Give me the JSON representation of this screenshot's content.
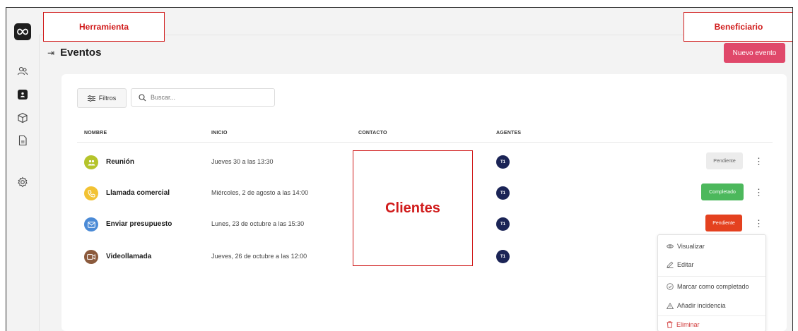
{
  "annotations": {
    "tool": "Herramienta",
    "beneficiary": "Beneficiario",
    "clients": "Clientes"
  },
  "sidebar": {
    "icons": [
      "infinity-logo-icon",
      "users-icon",
      "contact-book-icon",
      "cube-icon",
      "document-icon",
      "settings-icon"
    ],
    "active": "contact-book-icon"
  },
  "page": {
    "collapse_icon": "⇥",
    "title": "Eventos",
    "new_button": "Nuevo evento"
  },
  "toolbar": {
    "filters_label": "Filtros",
    "search_placeholder": "Buscar..."
  },
  "table": {
    "columns": [
      "NOMBRE",
      "INICIO",
      "CONTACTO",
      "AGENTES"
    ],
    "rows": [
      {
        "name": "Reunión",
        "date": "Jueves 30 a las 13:30",
        "agent": "T1",
        "status": "Pendiente",
        "icon": "meeting-icon",
        "icon_color": "#b5c42b",
        "status_bg": "#ececec",
        "status_fg": "#666666"
      },
      {
        "name": "Llamada comercial",
        "date": "Miércoles, 2 de agosto a las 14:00",
        "agent": "T1",
        "status": "Completado",
        "icon": "phone-icon",
        "icon_color": "#f2c233",
        "status_bg": "#4cb85c",
        "status_fg": "#ffffff"
      },
      {
        "name": "Enviar presupuesto",
        "date": "Lunes, 23 de octubre a las 15:30",
        "agent": "T1",
        "status": "Pendiente",
        "icon": "mail-icon",
        "icon_color": "#4a8ad6",
        "status_bg": "#e4411f",
        "status_fg": "#ffffff"
      },
      {
        "name": "Videollamada",
        "date": "Jueves, 26 de octubre a las 12:00",
        "agent": "T1",
        "status": "",
        "icon": "video-icon",
        "icon_color": "#8b5a3c",
        "status_bg": "",
        "status_fg": ""
      }
    ]
  },
  "context_menu": {
    "items": [
      {
        "label": "Visualizar",
        "icon": "eye-icon"
      },
      {
        "label": "Editar",
        "icon": "edit-icon"
      },
      {
        "label": "Marcar como completado",
        "icon": "check-circle-icon"
      },
      {
        "label": "Añadir incidencia",
        "icon": "warning-icon"
      },
      {
        "label": "Eliminar",
        "icon": "trash-icon",
        "color": "#d23b3b"
      }
    ]
  },
  "colors": {
    "accent": "#e0486a",
    "annotation": "#d01a1a",
    "agent_avatar": "#1b2456"
  }
}
